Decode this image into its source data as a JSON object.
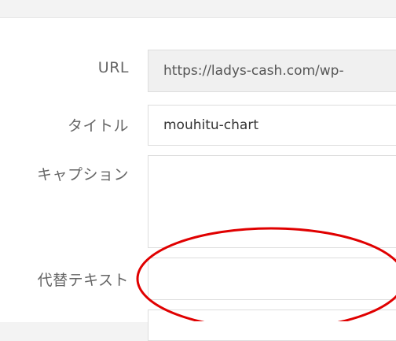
{
  "attachment_details": {
    "url": {
      "label": "URL",
      "value": "https://ladys-cash.com/wp-"
    },
    "title": {
      "label": "タイトル",
      "value": "mouhitu-chart"
    },
    "caption": {
      "label": "キャプション",
      "value": ""
    },
    "alt_text": {
      "label": "代替テキスト",
      "value": ""
    }
  },
  "colors": {
    "annotation": "#e00000",
    "label": "#666666",
    "field_border": "#dddddd",
    "readonly_bg": "#f0f0f0"
  }
}
